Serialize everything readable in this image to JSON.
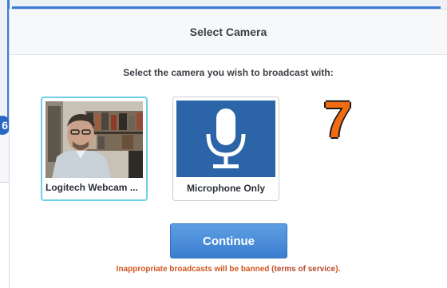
{
  "dialog": {
    "title": "Select Camera",
    "prompt": "Select the camera you wish to broadcast with:",
    "countdown": "7",
    "continue_label": "Continue",
    "warning_prefix": "Inappropriate broadcasts will be banned (",
    "terms_link": "terms of service",
    "warning_suffix": ")."
  },
  "cameras": [
    {
      "label": "Logitech Webcam ...",
      "selected": true
    },
    {
      "label": "Microphone Only",
      "selected": false,
      "icon": "microphone-icon"
    }
  ],
  "background": {
    "badge_text": "6"
  },
  "colors": {
    "accent": "#3b7bd8",
    "button": "#4a8ddb",
    "countdown": "#f36c12",
    "mic_tile": "#2b65a8",
    "warning": "#d0551f",
    "selected_border": "#6fcfe8"
  }
}
